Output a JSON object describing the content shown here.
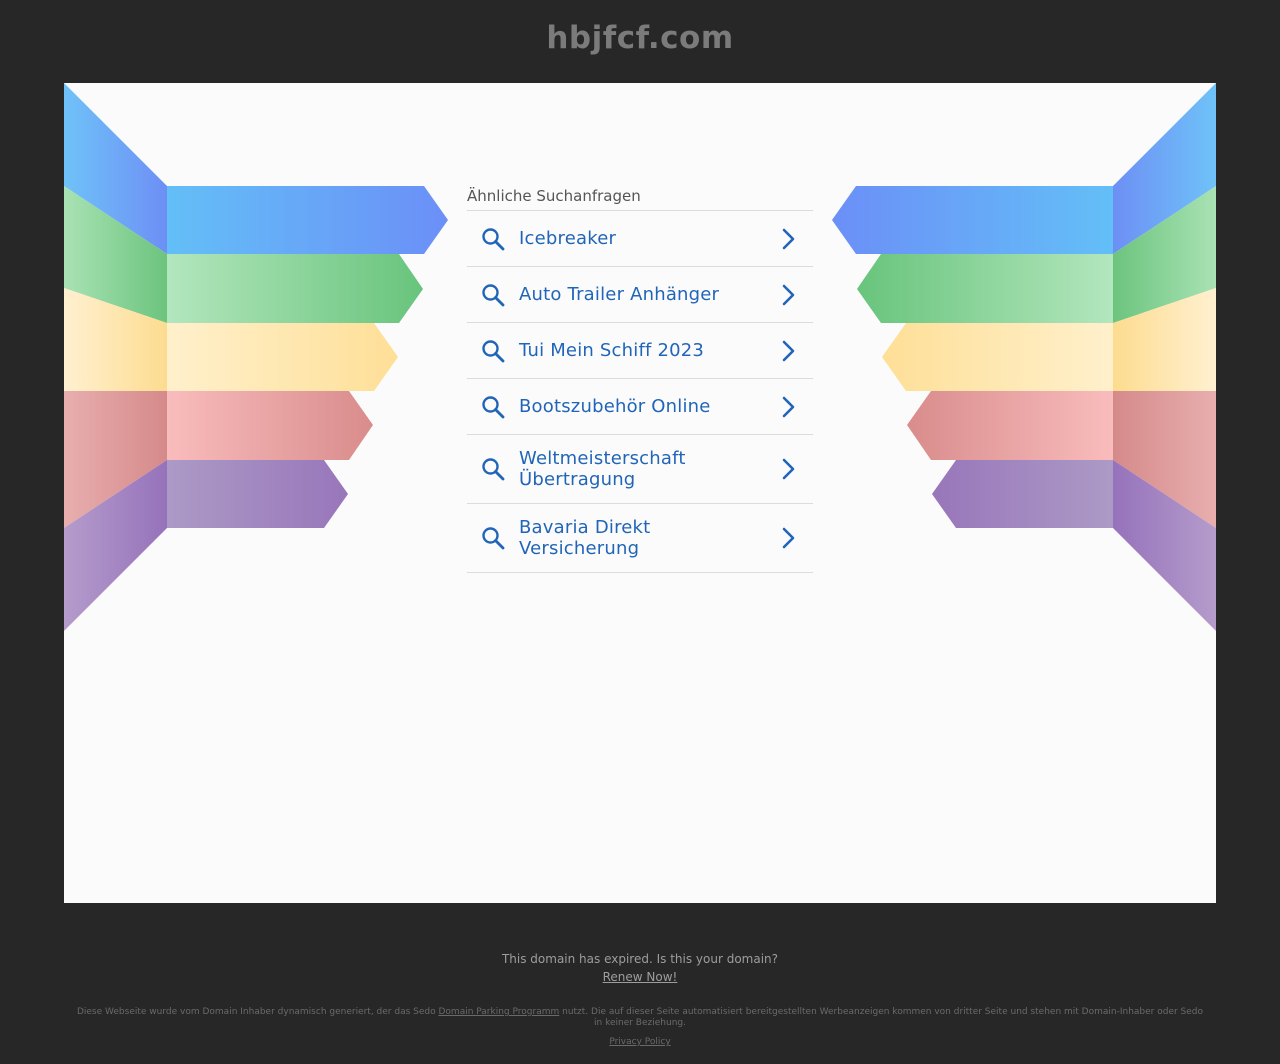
{
  "header": {
    "domain": "hbjfcf.com"
  },
  "related": {
    "heading": "Ähnliche Suchanfragen",
    "links": [
      {
        "label": "Icebreaker"
      },
      {
        "label": "Auto Trailer Anhänger"
      },
      {
        "label": "Tui Mein Schiff 2023"
      },
      {
        "label": "Bootszubehör Online"
      },
      {
        "label": "Weltmeisterschaft Übertragung"
      },
      {
        "label": "Bavaria Direkt Versicherung"
      }
    ]
  },
  "footer": {
    "expired_text": "This domain has expired. Is this your domain?",
    "renew_label": "Renew Now!",
    "disclaimer_before": "Diese Webseite wurde vom Domain Inhaber dynamisch generiert, der das Sedo ",
    "disclaimer_link": "Domain Parking Programm",
    "disclaimer_after": " nutzt. Die auf dieser Seite automatisiert bereitgestellten Werbeanzeigen kommen von dritter Seite und stehen mit Domain-Inhaber oder Sedo in keiner Beziehung.",
    "privacy_label": "Privacy Policy"
  },
  "colors": {
    "background": "#272727",
    "content_bg": "#fbfbfb",
    "link": "#2165b8",
    "blue": "#6ea8f5",
    "green": "#7fcf8f",
    "yellow": "#fde3a2",
    "red": "#e6a0a0",
    "purple": "#a98ac2"
  },
  "icons": {
    "search": "search-icon",
    "chevron": "chevron-right-icon"
  }
}
